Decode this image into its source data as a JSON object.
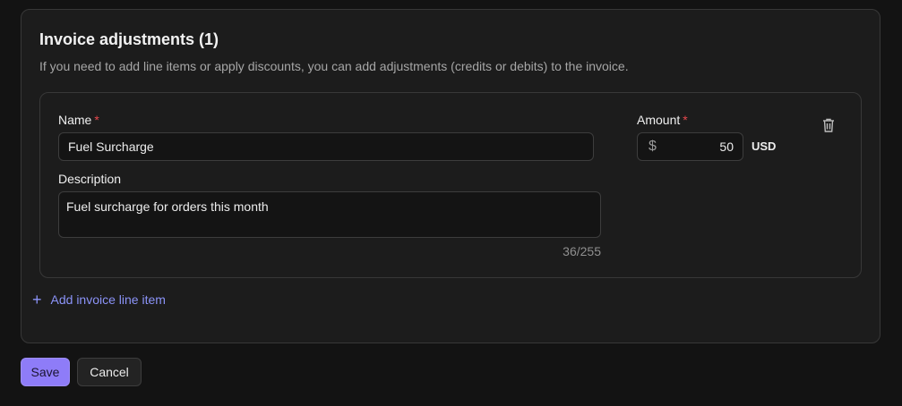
{
  "section": {
    "title": "Invoice adjustments (1)",
    "description": "If you need to add line items or apply discounts, you can add adjustments (credits or debits) to the invoice."
  },
  "adjustment": {
    "name_label": "Name",
    "name_value": "Fuel Surcharge",
    "description_label": "Description",
    "description_value": "Fuel surcharge for orders this month",
    "char_count": "36/255",
    "amount_label": "Amount",
    "currency_symbol": "$",
    "amount_value": "50",
    "currency_code": "USD",
    "required_marker": "*"
  },
  "add_line_item": {
    "icon": "plus-icon",
    "label": "Add invoice line item"
  },
  "actions": {
    "save_label": "Save",
    "cancel_label": "Cancel"
  },
  "colors": {
    "accent": "#8e7cf8",
    "link": "#8b93f8",
    "required": "#e5484d",
    "background": "#131313",
    "panel": "#1c1c1c"
  }
}
